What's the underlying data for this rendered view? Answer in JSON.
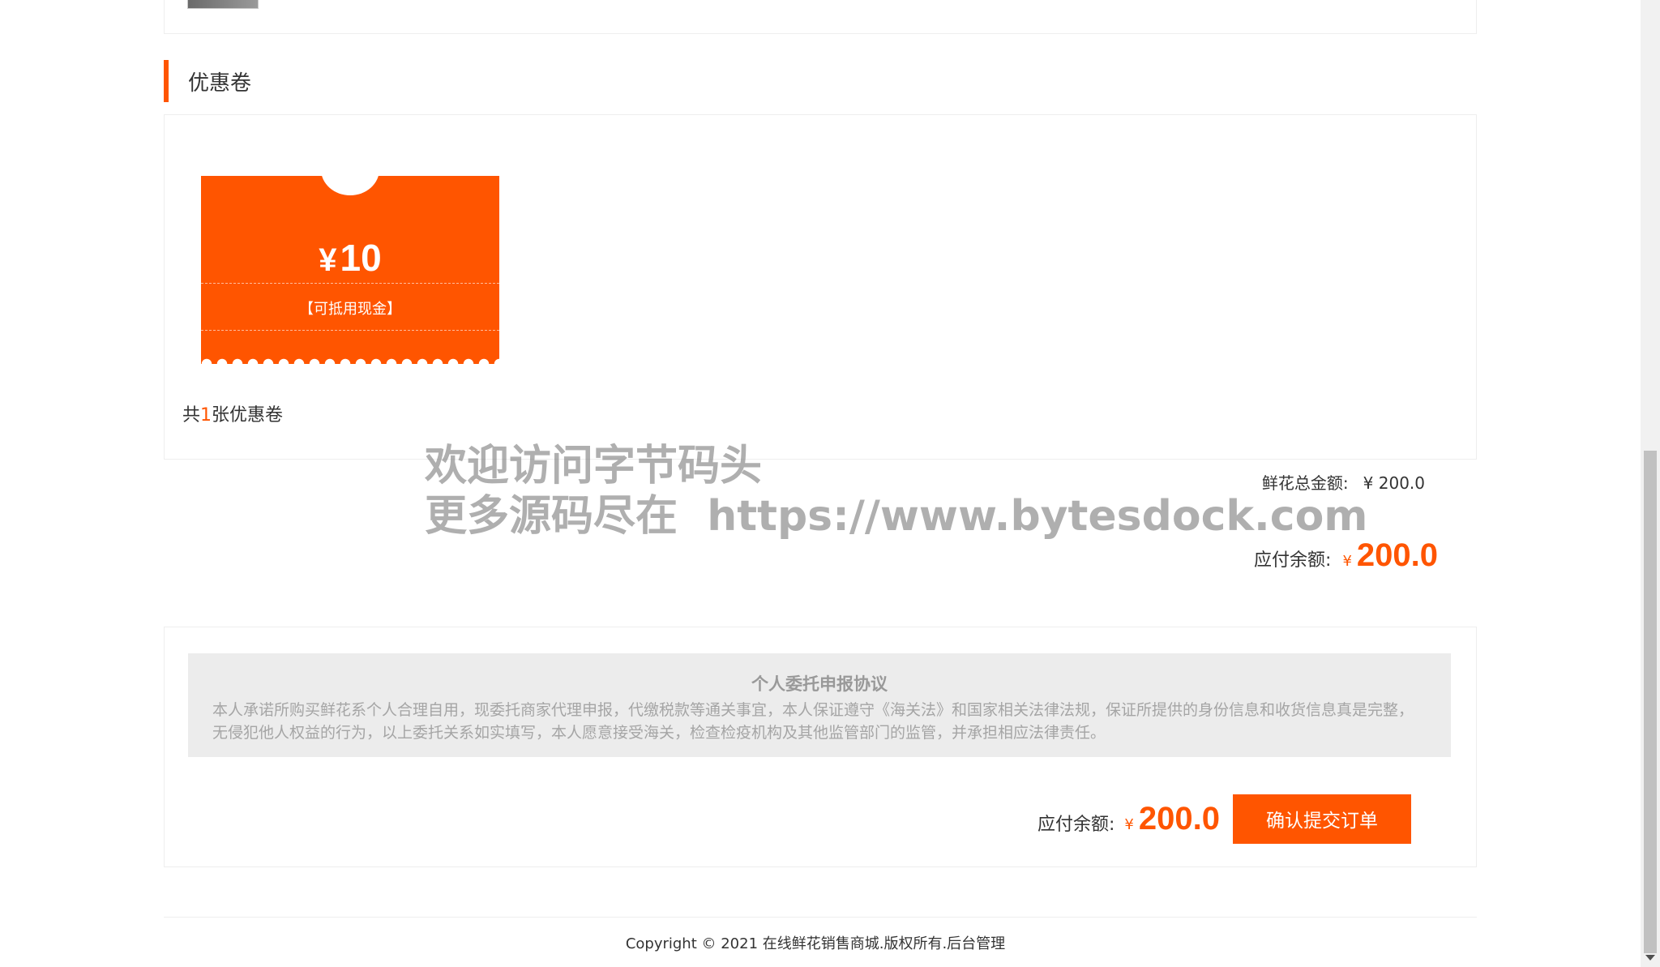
{
  "section": {
    "title": "优惠卷"
  },
  "coupon": {
    "currency_symbol": "¥",
    "amount": "10",
    "note": "【可抵用现金】",
    "count_prefix": "共",
    "count": "1",
    "count_suffix": "张优惠卷"
  },
  "totals": {
    "flower_total_label": "鲜花总金额:",
    "flower_total_value": "¥ 200.0",
    "payable_label": "应付余额:",
    "payable_symbol": "¥",
    "payable_value": "200.0"
  },
  "watermark": {
    "line1": "欢迎访问字节码头",
    "line2": "更多源码尽在  https://www.bytesdock.com"
  },
  "agreement": {
    "title": "个人委托申报协议",
    "text": "本人承诺所购买鲜花系个人合理自用，现委托商家代理申报，代缴税款等通关事宜，本人保证遵守《海关法》和国家相关法律法规，保证所提供的身份信息和收货信息真是完整，无侵犯他人权益的行为，以上委托关系如实填写，本人愿意接受海关，检查检疫机构及其他监管部门的监管，并承担相应法律责任。"
  },
  "submit": {
    "payable_label": "应付余额:",
    "payable_symbol": "¥",
    "payable_value": "200.0",
    "button_label": "确认提交订单"
  },
  "footer": {
    "text": "Copyright © 2021 在线鲜花销售商城.版权所有.后台管理"
  },
  "colors": {
    "accent": "#ff5500",
    "border": "#eeeeee",
    "agreement_bg": "#ececec"
  }
}
